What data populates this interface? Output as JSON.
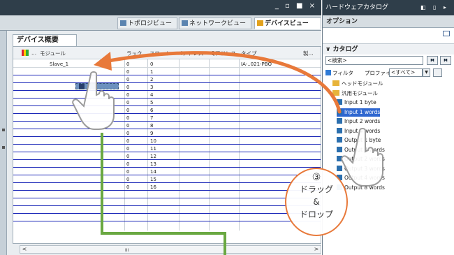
{
  "window": {
    "controls": "_ ▫ ■ ×"
  },
  "view_tabs": [
    {
      "label": "トポロジビュー",
      "active": false
    },
    {
      "label": "ネットワークビュー",
      "active": false
    },
    {
      "label": "デバイスビュー",
      "active": true
    }
  ],
  "editor": {
    "subtab": "デバイス概要",
    "headers": {
      "module": "モジュール",
      "rack": "ラック",
      "slot": "スロット",
      "i_address": "Iアドレス",
      "q_address": "Qアドレス",
      "type": "タイプ",
      "extra": "製..."
    },
    "rows": [
      {
        "module": "Slave_1",
        "rack": "0",
        "slot": "0",
        "type": "IA-..021-PBO"
      },
      {
        "module": "",
        "rack": "0",
        "slot": "1",
        "type": ""
      },
      {
        "module": "",
        "rack": "0",
        "slot": "2",
        "type": ""
      },
      {
        "module": "",
        "rack": "0",
        "slot": "3",
        "type": ""
      },
      {
        "module": "",
        "rack": "0",
        "slot": "4",
        "type": ""
      },
      {
        "module": "",
        "rack": "0",
        "slot": "5",
        "type": ""
      },
      {
        "module": "",
        "rack": "0",
        "slot": "6",
        "type": ""
      },
      {
        "module": "",
        "rack": "0",
        "slot": "7",
        "type": ""
      },
      {
        "module": "",
        "rack": "0",
        "slot": "8",
        "type": ""
      },
      {
        "module": "",
        "rack": "0",
        "slot": "9",
        "type": ""
      },
      {
        "module": "",
        "rack": "0",
        "slot": "10",
        "type": ""
      },
      {
        "module": "",
        "rack": "0",
        "slot": "11",
        "type": ""
      },
      {
        "module": "",
        "rack": "0",
        "slot": "12",
        "type": ""
      },
      {
        "module": "",
        "rack": "0",
        "slot": "13",
        "type": ""
      },
      {
        "module": "",
        "rack": "0",
        "slot": "14",
        "type": ""
      },
      {
        "module": "",
        "rack": "0",
        "slot": "15",
        "type": ""
      },
      {
        "module": "",
        "rack": "0",
        "slot": "16",
        "type": ""
      }
    ],
    "scroll_thumb": "III"
  },
  "catalog": {
    "title": "ハードウェアカタログ",
    "title_controls": "◧ ▯ ▸",
    "options_label": "オプション",
    "section_label": "カタログ",
    "search_placeholder": "<検索>",
    "search_btn1": "ᴍ",
    "search_btn2": "ᴍ",
    "filter_label": "フィルタ",
    "profile_label": "プロファイ",
    "profile_value": "<すべて>",
    "tree": [
      {
        "label": "ヘッドモジュール",
        "icon": "folder",
        "selected": false
      },
      {
        "label": "汎用モジュール",
        "icon": "folder",
        "selected": false
      },
      {
        "label": "Input 1 byte",
        "icon": "module",
        "selected": false
      },
      {
        "label": "Input 1 words",
        "icon": "module",
        "selected": true
      },
      {
        "label": "Input 2 words",
        "icon": "module",
        "selected": false
      },
      {
        "label": "Input 4 words",
        "icon": "module",
        "selected": false
      },
      {
        "label": "Output 1 byte",
        "icon": "module",
        "selected": false
      },
      {
        "label": "Output 1 words",
        "icon": "module",
        "selected": false
      },
      {
        "label": "Output 2 words",
        "icon": "module",
        "selected": false
      },
      {
        "label": "Output 3 words",
        "icon": "module",
        "selected": false
      },
      {
        "label": "Output 4 words",
        "icon": "module",
        "selected": false
      },
      {
        "label": "Output 8 words",
        "icon": "module",
        "selected": false
      }
    ]
  },
  "annotation": {
    "step_number": "③",
    "line1": "ドラッグ",
    "line2": "&",
    "line3": "ドロップ",
    "arrow_color": "#e8793a",
    "guide_color": "#6aa842"
  }
}
